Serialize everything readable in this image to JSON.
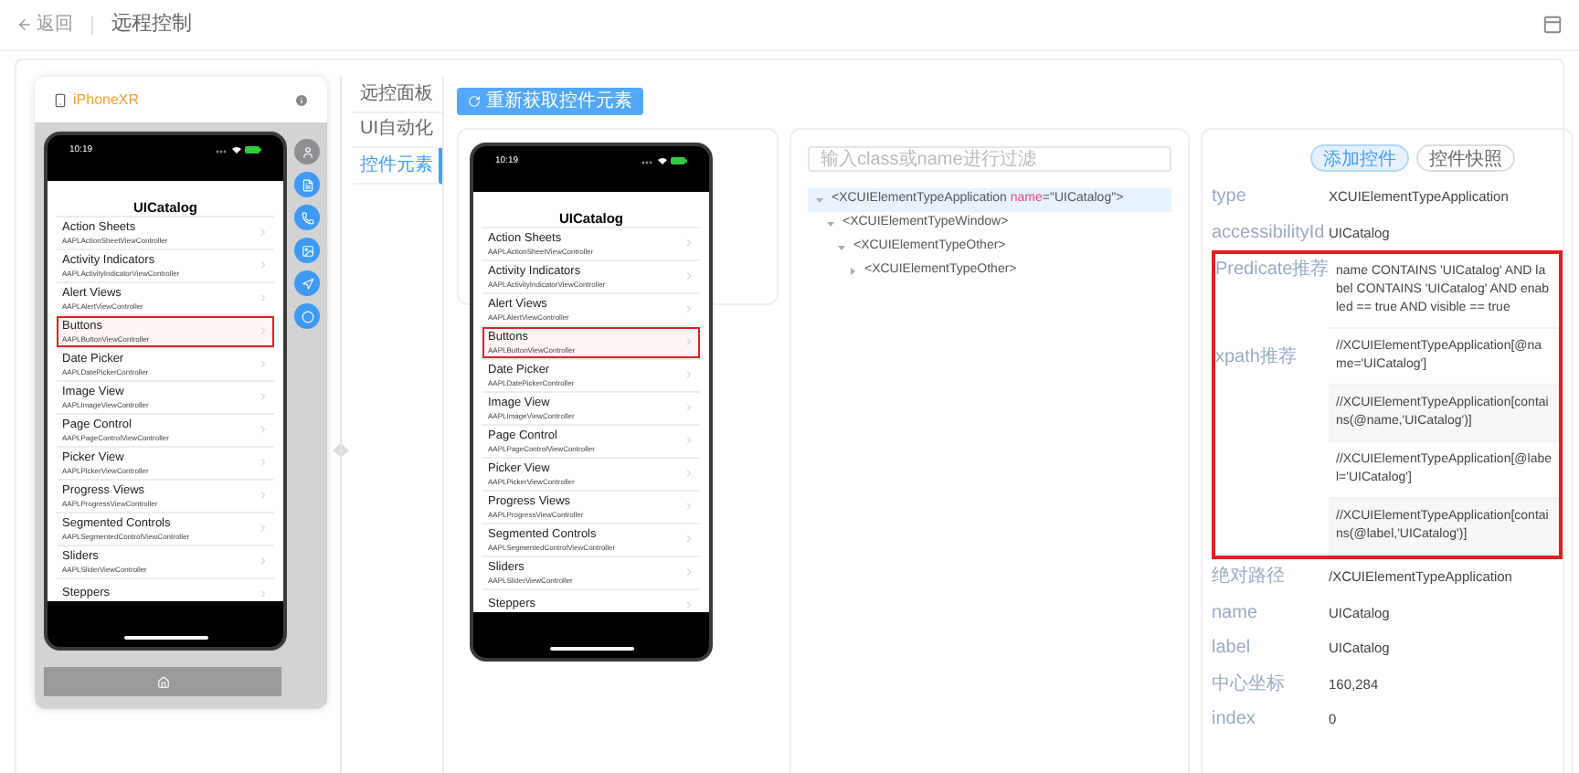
{
  "header": {
    "back": "返回",
    "title": "远程控制"
  },
  "device": {
    "name": "iPhoneXR",
    "side_buttons": [
      {
        "kind": "person",
        "color": "#8e8e93"
      },
      {
        "kind": "document",
        "color": "#3d9af5"
      },
      {
        "kind": "phone",
        "color": "#3d9af5"
      },
      {
        "kind": "image",
        "color": "#3d9af5"
      },
      {
        "kind": "location",
        "color": "#3d9af5"
      },
      {
        "kind": "power",
        "color": "#3d9af5"
      }
    ],
    "phone": {
      "time": "10:19",
      "title": "UICatalog",
      "rows": [
        {
          "title": "Action Sheets",
          "subtitle": "AAPLActionSheetViewController",
          "highlighted": false
        },
        {
          "title": "Activity Indicators",
          "subtitle": "AAPLActivityIndicatorViewController",
          "highlighted": false
        },
        {
          "title": "Alert Views",
          "subtitle": "AAPLAlertViewController",
          "highlighted": false
        },
        {
          "title": "Buttons",
          "subtitle": "AAPLButtonViewController",
          "highlighted": true
        },
        {
          "title": "Date Picker",
          "subtitle": "AAPLDatePickerController",
          "highlighted": false
        },
        {
          "title": "Image View",
          "subtitle": "AAPLImageViewController",
          "highlighted": false
        },
        {
          "title": "Page Control",
          "subtitle": "AAPLPageControlViewController",
          "highlighted": false
        },
        {
          "title": "Picker View",
          "subtitle": "AAPLPickerViewController",
          "highlighted": false
        },
        {
          "title": "Progress Views",
          "subtitle": "AAPLProgressViewController",
          "highlighted": false
        },
        {
          "title": "Segmented Controls",
          "subtitle": "AAPLSegmentedControlViewController",
          "highlighted": false
        },
        {
          "title": "Sliders",
          "subtitle": "AAPLSliderViewController",
          "highlighted": false
        },
        {
          "title": "Steppers",
          "highlighted": false
        }
      ]
    }
  },
  "tabs": [
    {
      "label": "远控面板",
      "selected": false
    },
    {
      "label": "UI自动化",
      "selected": false
    },
    {
      "label": "控件元素",
      "selected": true
    }
  ],
  "refresh_button": "重新获取控件元素",
  "preview_phone": {
    "time": "10:19",
    "title": "UICatalog",
    "rows": [
      {
        "title": "Action Sheets",
        "subtitle": "AAPLActionSheetViewController",
        "highlighted": false
      },
      {
        "title": "Activity Indicators",
        "subtitle": "AAPLActivityIndicatorViewController",
        "highlighted": false
      },
      {
        "title": "Alert Views",
        "subtitle": "AAPLAlertViewController",
        "highlighted": false
      },
      {
        "title": "Buttons",
        "subtitle": "AAPLButtonViewController",
        "highlighted": true
      },
      {
        "title": "Date Picker",
        "subtitle": "AAPLDatePickerController",
        "highlighted": false
      },
      {
        "title": "Image View",
        "subtitle": "AAPLImageViewController",
        "highlighted": false
      },
      {
        "title": "Page Control",
        "subtitle": "AAPLPageControlViewController",
        "highlighted": false
      },
      {
        "title": "Picker View",
        "subtitle": "AAPLPickerViewController",
        "highlighted": false
      },
      {
        "title": "Progress Views",
        "subtitle": "AAPLProgressViewController",
        "highlighted": false
      },
      {
        "title": "Segmented Controls",
        "subtitle": "AAPLSegmentedControlViewController",
        "highlighted": false
      },
      {
        "title": "Sliders",
        "subtitle": "AAPLSliderViewController",
        "highlighted": false
      },
      {
        "title": "Steppers",
        "highlighted": false
      }
    ]
  },
  "tree": {
    "placeholder": "输入class或name进行过滤",
    "nodes": [
      {
        "label": "<XCUIElementTypeApplication",
        "attribute": "name",
        "attribute_value": "=\"UICatalog\">",
        "expanded": true,
        "selected": true,
        "children": [
          {
            "label": "<XCUIElementTypeWindow>",
            "expanded": true,
            "selected": false,
            "children": [
              {
                "label": "<XCUIElementTypeOther>",
                "expanded": true,
                "selected": false,
                "children": [
                  {
                    "label": "<XCUIElementTypeOther>",
                    "expanded": false,
                    "selected": false
                  }
                ]
              }
            ]
          }
        ]
      }
    ]
  },
  "properties": {
    "buttons": [
      {
        "label": "添加控件",
        "selected": true
      },
      {
        "label": "控件快照",
        "selected": false
      }
    ],
    "fields_top": [
      {
        "label": "type",
        "value": "XCUIElementTypeApplication"
      },
      {
        "label": "accessibilityId",
        "value": "UICatalog"
      }
    ],
    "recommendations": {
      "highlighted": true,
      "groups": [
        {
          "label": "Predicate推荐",
          "values": [
            "name CONTAINS 'UICatalog' AND label CONTAINS 'UICatalog' AND enabled == true AND visible == true"
          ]
        },
        {
          "label": "xpath推荐",
          "values": [
            "//XCUIElementTypeApplication[@name='UICatalog']",
            "//XCUIElementTypeApplication[contains(@name,'UICatalog')]",
            "//XCUIElementTypeApplication[@label='UICatalog']",
            "//XCUIElementTypeApplication[contains(@label,'UICatalog')]"
          ]
        }
      ]
    },
    "fields_bottom": [
      {
        "label": "绝对路径",
        "value": "/XCUIElementTypeApplication"
      },
      {
        "label": "name",
        "value": "UICatalog"
      },
      {
        "label": "label",
        "value": "UICatalog"
      },
      {
        "label": "中心坐标",
        "value": "160,284"
      },
      {
        "label": "index",
        "value": "0"
      }
    ]
  }
}
